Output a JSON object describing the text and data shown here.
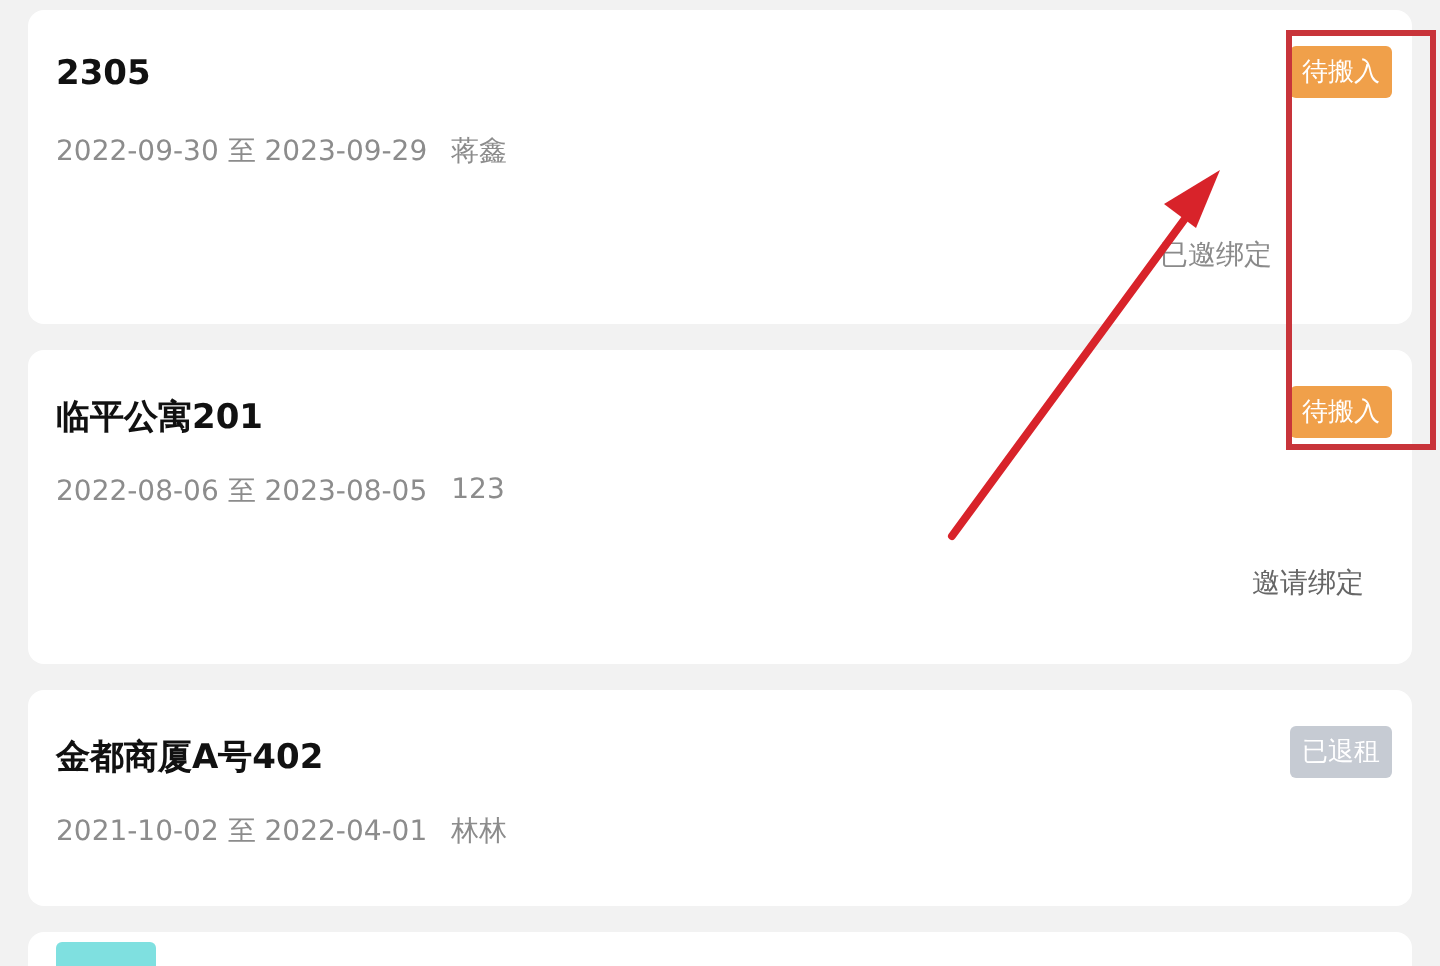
{
  "cards": [
    {
      "title": "2305",
      "period": "2022-09-30 至 2023-09-29",
      "tenant": "蒋鑫",
      "tag": {
        "text": "待搬入",
        "kind": "pending"
      },
      "action": {
        "text": "已邀绑定",
        "kind": "label"
      }
    },
    {
      "title": "临平公寓201",
      "period": "2022-08-06 至 2023-08-05",
      "tenant": "123",
      "tag": {
        "text": "待搬入",
        "kind": "pending"
      },
      "action": {
        "text": "邀请绑定",
        "kind": "button"
      }
    },
    {
      "title": "金都商厦A号402",
      "period": "2021-10-02 至 2022-04-01",
      "tenant": "林林",
      "tag": {
        "text": "已退租",
        "kind": "ended"
      }
    },
    {
      "tag": {
        "kind": "active"
      }
    }
  ]
}
